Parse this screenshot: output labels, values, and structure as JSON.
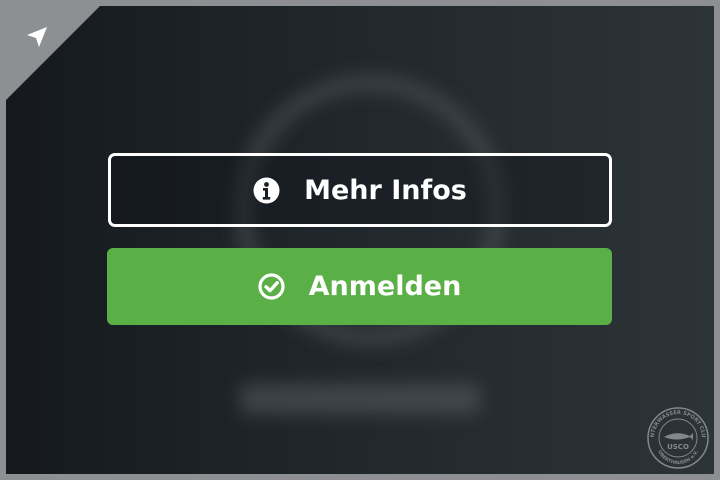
{
  "buttons": {
    "info_label": "Mehr Infos",
    "login_label": "Anmelden"
  },
  "icons": {
    "corner": "location-arrow-icon",
    "info": "info-circle-icon",
    "login": "check-circle-icon"
  },
  "logo": {
    "top_text": "UNTERWASSER SPORT CLUB",
    "center_text": "USCO",
    "bottom_text": "OBERTHAUSEN e.V."
  },
  "colors": {
    "login_button": "#5ab046",
    "info_border": "#ffffff",
    "frame": "#8d8f92"
  }
}
